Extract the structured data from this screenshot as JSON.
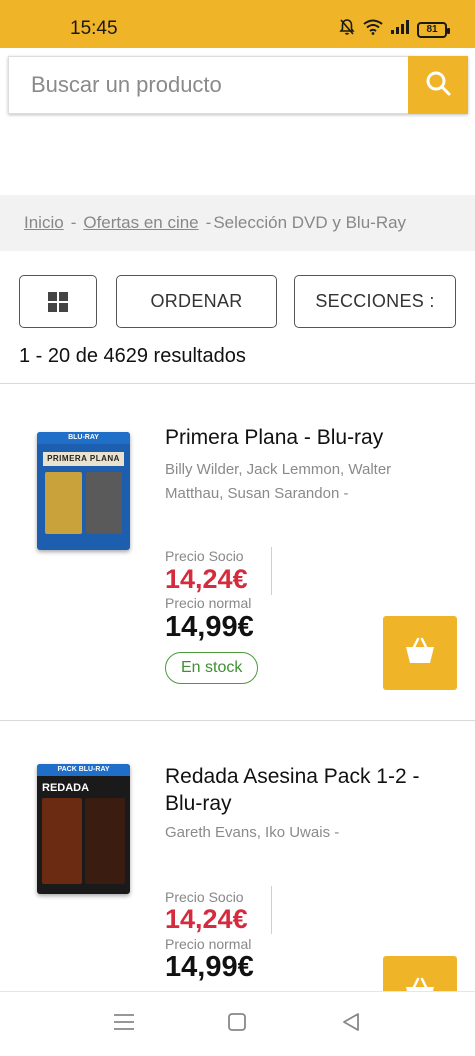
{
  "status": {
    "time": "15:45",
    "battery": "81"
  },
  "search": {
    "placeholder": "Buscar un producto"
  },
  "breadcrumb": {
    "home": "Inicio",
    "section": "Ofertas en cine",
    "current": "Selección DVD y Blu-Ray",
    "separator": "-"
  },
  "toolbar": {
    "sort_label": "ORDENAR",
    "sections_label": "SECCIONES :"
  },
  "results_text": "1 - 20 de 4629 resultados",
  "colors": {
    "accent": "#f0b429",
    "price_red": "#d52b3e",
    "stock_green": "#3f8f33"
  },
  "products": [
    {
      "title": "Primera Plana - Blu-ray",
      "authors": "Billy Wilder, Jack Lemmon, Walter Matthau, Susan Sarandon -",
      "socio_label": "Precio Socio",
      "socio_price": "14,24€",
      "normal_label": "Precio normal",
      "normal_price": "14,99€",
      "stock": "En stock",
      "cover_text": "PRIMERA PLANA"
    },
    {
      "title": "Redada Asesina Pack 1-2 - Blu-ray",
      "authors": "Gareth Evans, Iko Uwais -",
      "socio_label": "Precio Socio",
      "socio_price": "14,24€",
      "normal_label": "Precio normal",
      "normal_price": "14,99€",
      "cover_text": "REDADA"
    }
  ],
  "icons": [
    "search-icon",
    "grid-view-icon",
    "shopping-basket-icon",
    "menu-icon",
    "home-square-icon",
    "back-triangle-icon",
    "mute-bell-icon",
    "wifi-icon",
    "signal-icon",
    "battery-icon"
  ]
}
